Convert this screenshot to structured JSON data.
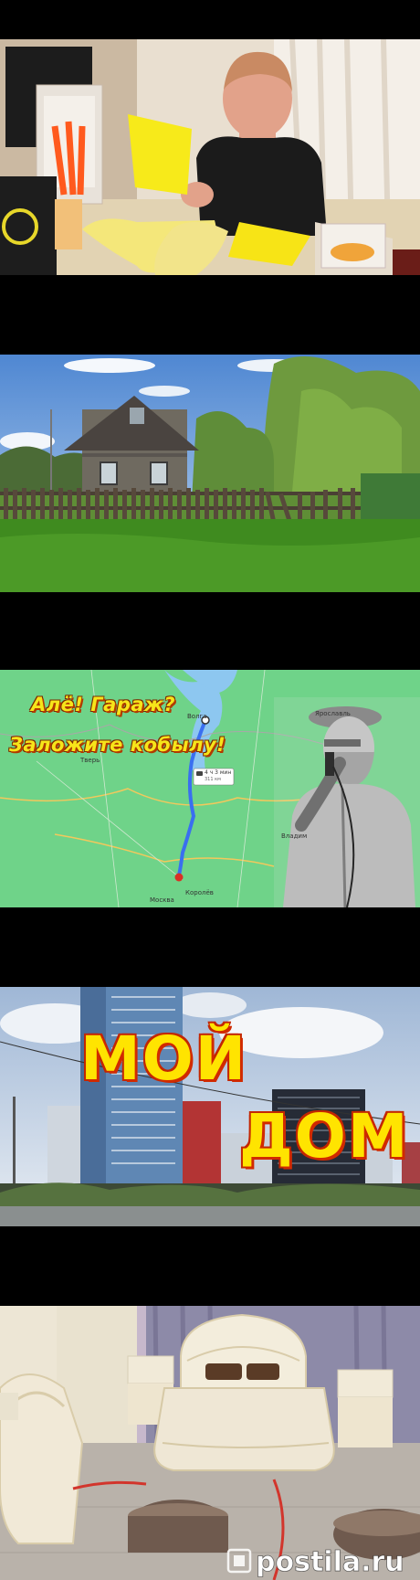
{
  "frames": [
    {
      "id": "kitchen-tv",
      "scene": "woman-with-cloths"
    },
    {
      "id": "village-house",
      "scene": "wooden-house"
    },
    {
      "id": "route-map",
      "scene": "map",
      "overlay_line1": "Алё! Гараж?",
      "overlay_line2": "Заложите кобылу!",
      "places": {
        "volga": "Волга",
        "yaroslavl": "Ярославль",
        "moscow": "Москва",
        "korolev": "Королёв",
        "tver": "Тверь",
        "vladimir": "Владим"
      },
      "route_time": "4 ч 3 мин",
      "route_dist": "311 км"
    },
    {
      "id": "city-buildings",
      "scene": "buildings",
      "title_word1": "МОЙ",
      "title_word2": "ДОМ"
    },
    {
      "id": "bedroom",
      "scene": "bedroom",
      "watermark": "postila.ru"
    }
  ],
  "colors": {
    "background": "#000000",
    "map_land": "#6fd389",
    "route": "#3a6ff0",
    "overlay_yellow": "#f6e51a",
    "title_yellow": "#ffe400"
  }
}
